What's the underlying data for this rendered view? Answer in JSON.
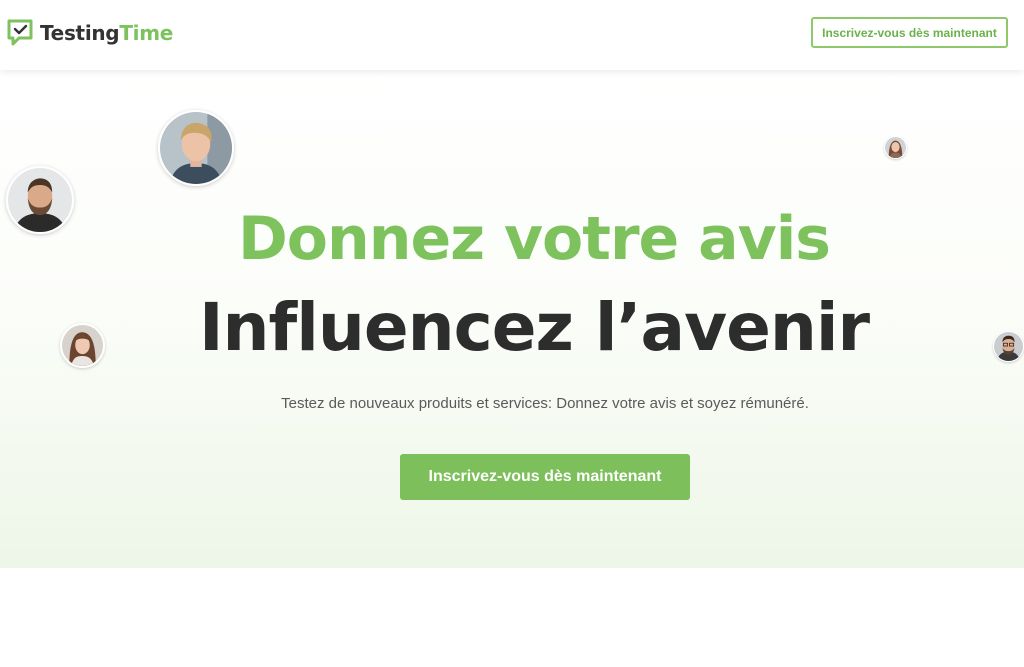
{
  "header": {
    "logo": {
      "icon": "chat-check-icon",
      "text_part1": "Testing",
      "text_part2": "Time"
    },
    "signup_button_label": "Inscrivez-vous dès maintenant"
  },
  "hero": {
    "headline_line1": "Donnez votre avis",
    "headline_line2": "Influencez l’avenir",
    "subtitle": "Testez de nouveaux produits et services: Donnez votre avis et soyez rémunéré.",
    "cta_label": "Inscrivez-vous dès maintenant"
  },
  "colors": {
    "brand_green": "#7ec25d",
    "button_green": "#7dbf5a",
    "text_dark": "#2d2d2d"
  }
}
